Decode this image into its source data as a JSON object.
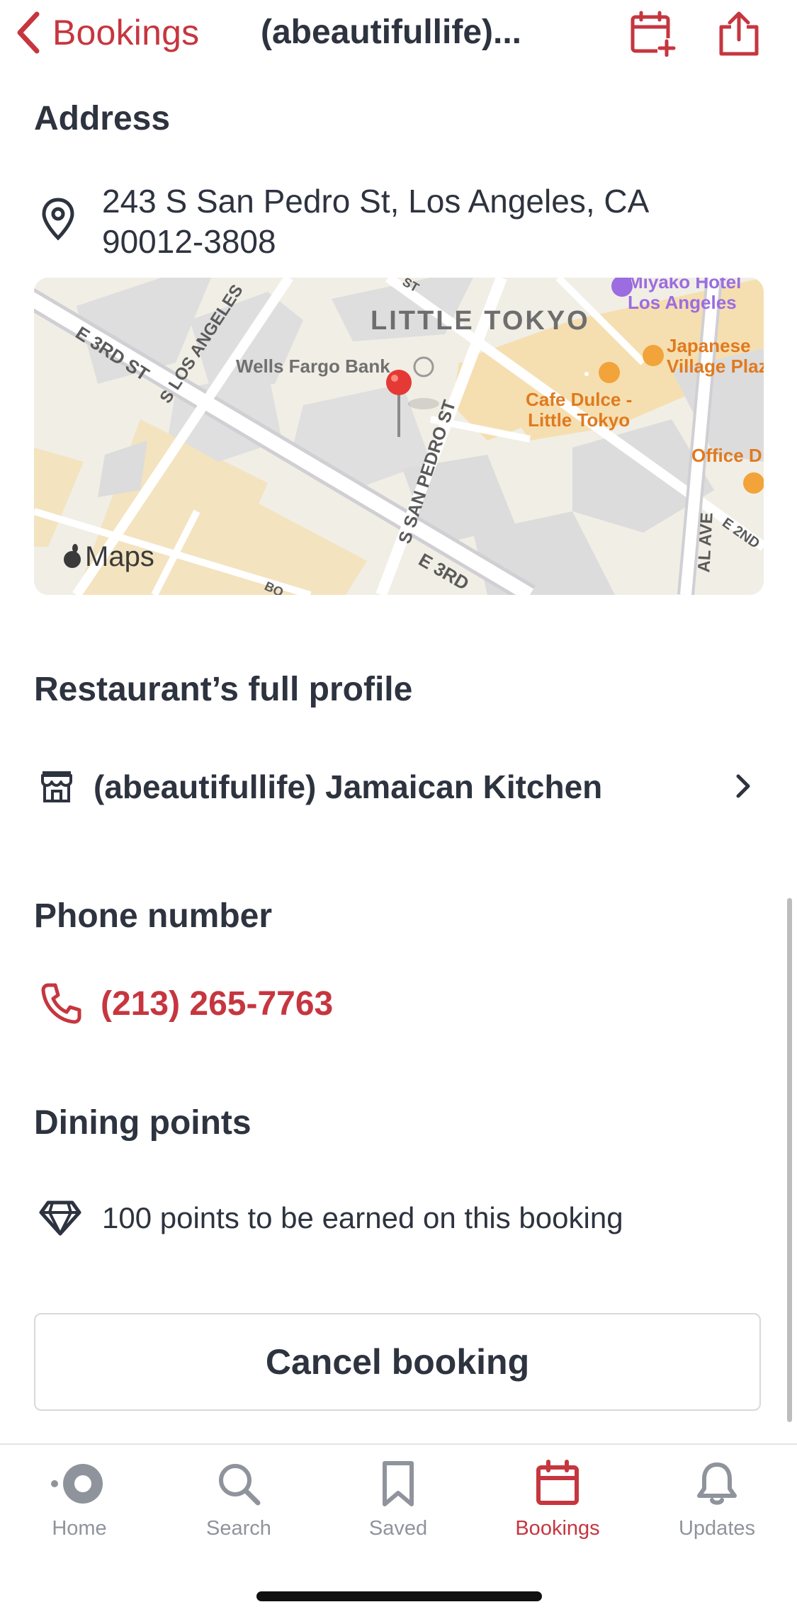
{
  "nav": {
    "back_label": "Bookings",
    "title": "(abeautifullife)...",
    "add_calendar_icon": "calendar-plus-icon",
    "share_icon": "share-icon"
  },
  "address": {
    "title": "Address",
    "line1": "243 S San Pedro St, Los Angeles, CA",
    "line2": "90012-3808"
  },
  "map": {
    "labels": {
      "little_tokyo": "LITTLE TOKYO",
      "wells_fargo": "Wells Fargo Bank",
      "e3rd_a": "E 3RD ST",
      "s_los_angeles": "S LOS ANGELES",
      "s_san_pedro": "S SAN PEDRO ST",
      "e3rd_b": "E 3RD",
      "cafe_1": "Cafe Dulce -",
      "cafe_2": "Little Tokyo",
      "japanese_1": "Japanese",
      "japanese_2": "Village Plaza",
      "miyako_1": "Miyako Hotel",
      "miyako_2": "Los Angeles",
      "office": "Office D",
      "al_ave": "AL AVE",
      "e2nd": "E 2ND",
      "maps_brand": "Maps",
      "st_top": "ST",
      "bo": "BO"
    }
  },
  "profile": {
    "title": "Restaurant’s full profile",
    "name": "(abeautifullife) Jamaican Kitchen"
  },
  "phone": {
    "title": "Phone number",
    "number": "(213) 265-7763"
  },
  "points": {
    "title": "Dining points",
    "text": "100 points to be earned on this booking"
  },
  "cancel_label": "Cancel booking",
  "tabs": [
    {
      "label": "Home",
      "icon": "home-icon"
    },
    {
      "label": "Search",
      "icon": "search-icon"
    },
    {
      "label": "Saved",
      "icon": "bookmark-icon"
    },
    {
      "label": "Bookings",
      "icon": "calendar-icon",
      "active": true
    },
    {
      "label": "Updates",
      "icon": "bell-icon"
    }
  ],
  "colors": {
    "accent": "#c6363f",
    "text": "#2d333f",
    "muted": "#8f949c"
  }
}
